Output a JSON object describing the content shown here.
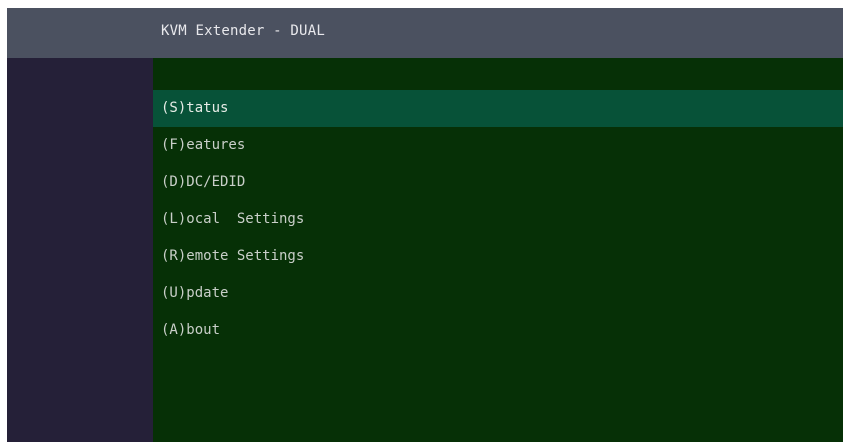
{
  "window": {
    "title": "KVM Extender - DUAL"
  },
  "menu": {
    "selected_index": 0,
    "items": [
      {
        "label": "(S)tatus",
        "name": "menu-item-status"
      },
      {
        "label": "(F)eatures",
        "name": "menu-item-features"
      },
      {
        "label": "(D)DC/EDID",
        "name": "menu-item-ddc-edid"
      },
      {
        "label": "(L)ocal  Settings",
        "name": "menu-item-local-settings"
      },
      {
        "label": "(R)emote Settings",
        "name": "menu-item-remote-settings"
      },
      {
        "label": "(U)pdate",
        "name": "menu-item-update"
      },
      {
        "label": "(A)bout",
        "name": "menu-item-about"
      }
    ]
  },
  "colors": {
    "title_bar": "#4b5160",
    "sidebar": "#252038",
    "content_background": "#063006",
    "selected_row": "#075238",
    "text": "#c9cfc9"
  }
}
